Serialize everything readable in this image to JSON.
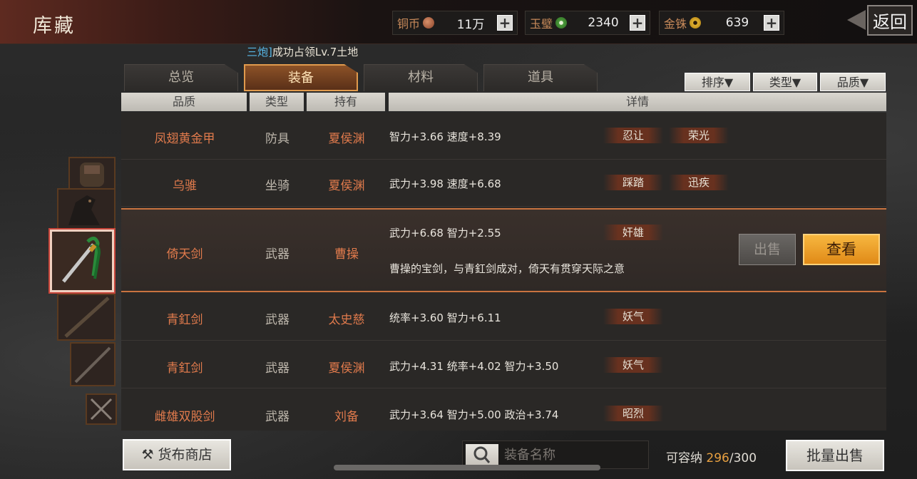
{
  "header": {
    "title": "库藏",
    "back_label": "返回",
    "currencies": [
      {
        "label": "铜币",
        "value": "11万",
        "color": "#a85a3a"
      },
      {
        "label": "玉璧",
        "value": "2340",
        "color": "#3e8a3a"
      },
      {
        "label": "金铢",
        "value": "639",
        "color": "#c89a20"
      }
    ]
  },
  "notice": {
    "highlight": "三炮]",
    "text": "成功占领Lv.7土地"
  },
  "tabs": [
    {
      "label": "总览",
      "active": false
    },
    {
      "label": "装备",
      "active": true
    },
    {
      "label": "材料",
      "active": false
    },
    {
      "label": "道具",
      "active": false
    }
  ],
  "filters": [
    "排序▼",
    "类型▼",
    "品质▼"
  ],
  "columns": [
    "品质",
    "类型",
    "持有",
    "详情"
  ],
  "rows": [
    {
      "name": "凤翅黄金甲",
      "type": "防具",
      "owner": "夏侯渊",
      "stats": "智力+3.66  速度+8.39",
      "traits": [
        "忍让",
        "荣光"
      ]
    },
    {
      "name": "乌骓",
      "type": "坐骑",
      "owner": "夏侯渊",
      "stats": "武力+3.98  速度+6.68",
      "traits": [
        "踩踏",
        "迅疾"
      ]
    },
    {
      "name": "倚天剑",
      "type": "武器",
      "owner": "曹操",
      "stats": "武力+6.68  智力+2.55",
      "traits": [
        "奸雄"
      ],
      "desc": "曹操的宝剑，与青釭剑成对，倚天有贯穿天际之意",
      "selected": true
    },
    {
      "name": "青釭剑",
      "type": "武器",
      "owner": "太史慈",
      "stats": "统率+3.60  智力+6.11",
      "traits": [
        "妖气"
      ]
    },
    {
      "name": "青釭剑",
      "type": "武器",
      "owner": "夏侯渊",
      "stats": "武力+4.31  统率+4.02  智力+3.50",
      "traits": [
        "妖气"
      ]
    },
    {
      "name": "雌雄双股剑",
      "type": "武器",
      "owner": "刘备",
      "stats": "武力+3.64  智力+5.00  政治+3.74",
      "traits": [
        "昭烈"
      ]
    }
  ],
  "actions": {
    "sell_label": "出售",
    "view_label": "查看"
  },
  "bottom": {
    "shop_label": "货布商店",
    "search_placeholder": "装备名称",
    "capacity_prefix": "可容纳 ",
    "capacity_used": "296",
    "capacity_total": "/300",
    "bulk_sell_label": "批量出售"
  }
}
